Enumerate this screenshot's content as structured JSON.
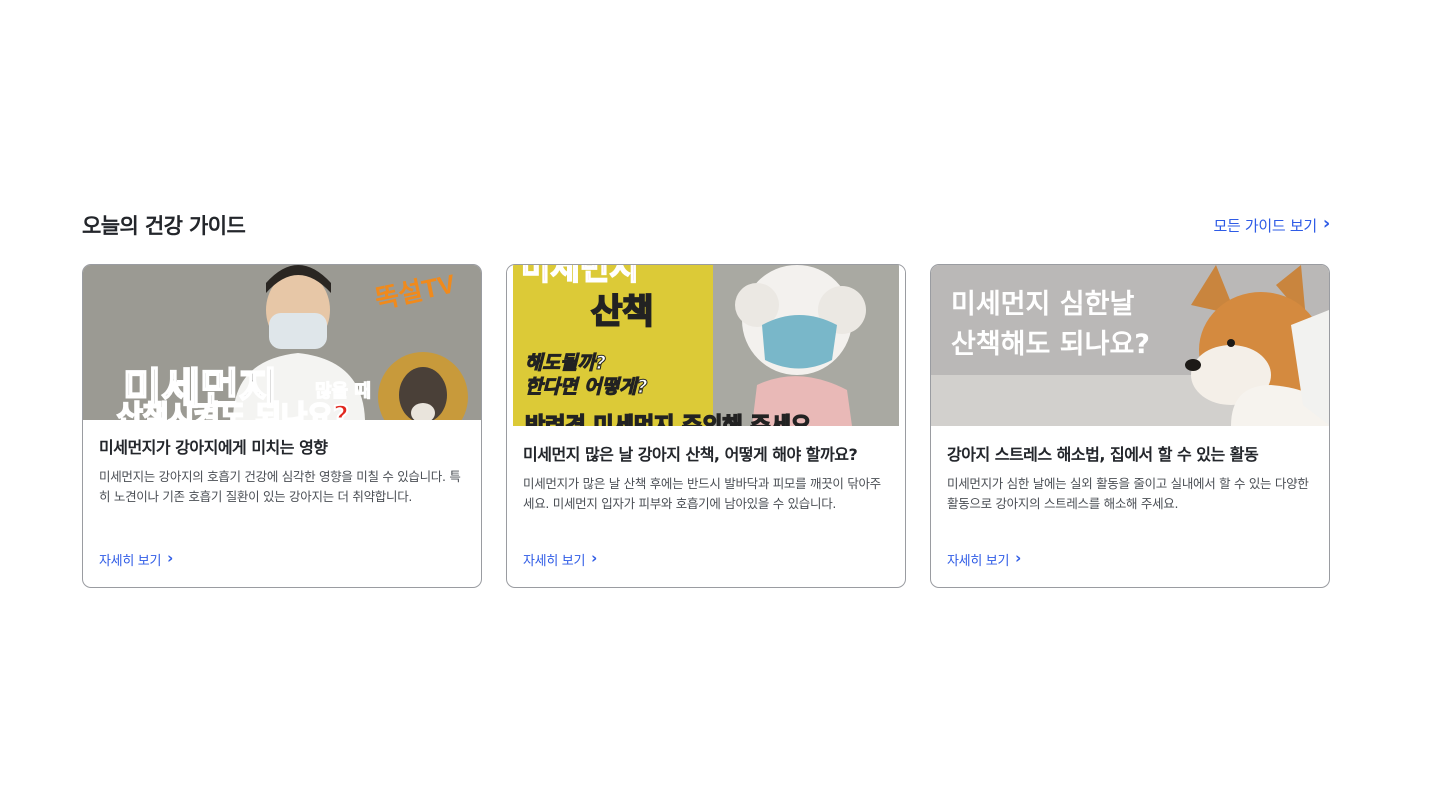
{
  "section": {
    "title": "오늘의 건강 가이드",
    "all_link": "모든 가이드 보기"
  },
  "cards": [
    {
      "thumb_text": [
        "똑설TV",
        "미세먼지",
        "많을 때",
        "산책시켜도 되나요?"
      ],
      "title": "미세먼지가 강아지에게 미치는 영향",
      "description": "미세먼지는 강아지의 호흡기 건강에 심각한 영향을 미칠 수 있습니다. 특히 노견이나 기존 호흡기 질환이 있는 강아지는 더 취약합니다.",
      "link": "자세히 보기"
    },
    {
      "thumb_text": [
        "미세먼지",
        "산책",
        "해도될까?",
        "한다면 어떻게?",
        "반려견 미세먼지 주의해 주세요"
      ],
      "title": "미세먼지 많은 날 강아지 산책, 어떻게 해야 할까요?",
      "description": "미세먼지가 많은 날 산책 후에는 반드시 발바닥과 피모를 깨끗이 닦아주세요. 미세먼지 입자가 피부와 호흡기에 남아있을 수 있습니다.",
      "link": "자세히 보기"
    },
    {
      "thumb_text": [
        "미세먼지 심한날",
        "산책해도 되나요?"
      ],
      "title": "강아지 스트레스 해소법, 집에서 할 수 있는 활동",
      "description": "미세먼지가 심한 날에는 실외 활동을 줄이고 실내에서 할 수 있는 다양한 활동으로 강아지의 스트레스를 해소해 주세요.",
      "link": "자세히 보기"
    }
  ],
  "colors": {
    "accent": "#2e5be6",
    "title": "#23262b",
    "border": "#9a9ca1"
  },
  "icons": {
    "chevron": "chevron-right-icon"
  }
}
